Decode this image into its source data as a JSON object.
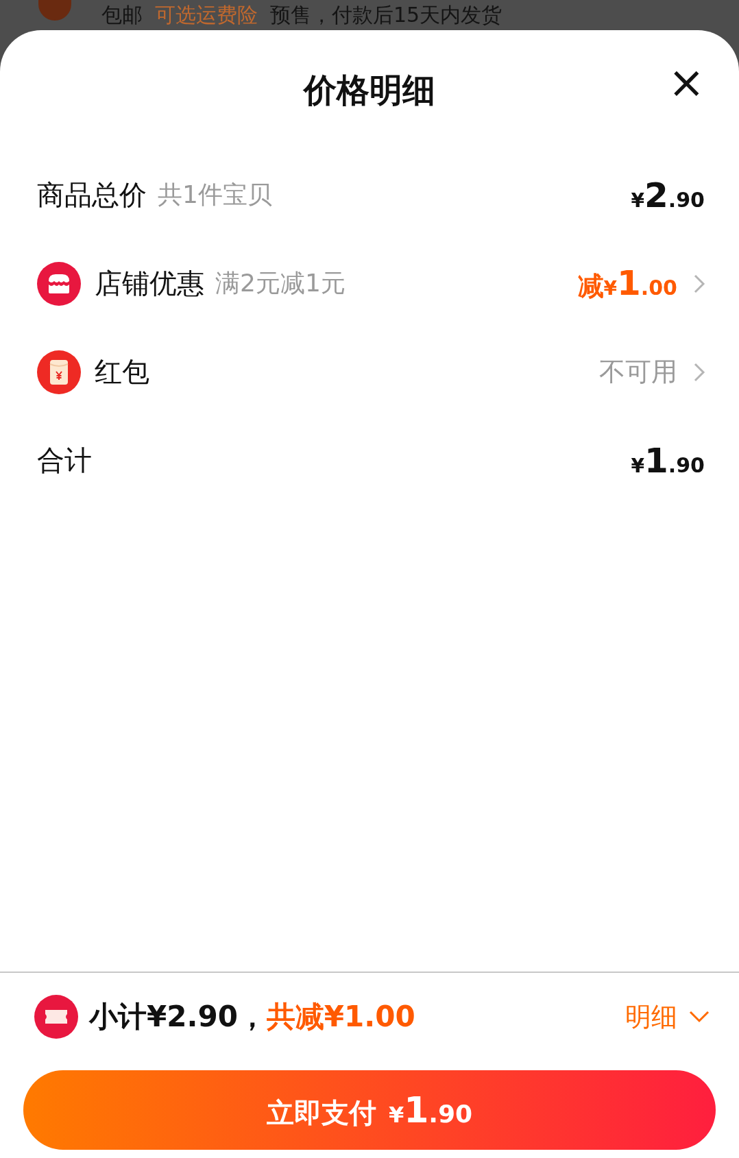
{
  "background": {
    "parts": [
      {
        "text": "包邮",
        "kind": "plain"
      },
      {
        "text": "可选运费险",
        "kind": "link"
      },
      {
        "text": "预售，付款后15天内发货",
        "kind": "plain"
      }
    ]
  },
  "sheet": {
    "title": "价格明细",
    "close": "×",
    "rows": [
      {
        "kind": "price",
        "label": "商品总价",
        "note": "共1件宝贝",
        "amount": {
          "currency": "¥",
          "integer": "2",
          "decimal": ".90"
        },
        "has_arrow": false
      },
      {
        "kind": "discount",
        "label": "店铺优惠",
        "note": "满2元减1元",
        "amount": {
          "prefix": "减",
          "currency": "¥",
          "integer": "1",
          "decimal": ".00"
        },
        "has_arrow": true
      },
      {
        "kind": "status",
        "label": "红包",
        "status": "不可用",
        "has_arrow": true
      },
      {
        "kind": "price",
        "label": "合计",
        "amount": {
          "currency": "¥",
          "integer": "1",
          "decimal": ".90"
        },
        "has_arrow": false
      }
    ]
  },
  "footer": {
    "subtotal": "小计¥2.90，",
    "saved": "共减¥1.00",
    "details": "明细",
    "details_expanded": false,
    "pay_button": {
      "label": "立即支付",
      "currency": "¥",
      "integer": "1",
      "decimal": ".90"
    }
  }
}
